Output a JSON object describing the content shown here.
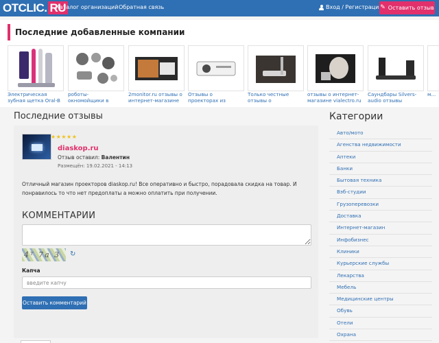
{
  "navbar": {
    "logo_main": "OTCLIC.",
    "logo_tld": "RU",
    "catalog_link": "Каталог организаций",
    "feedback_link": "Обратная связь",
    "login_link": "Вход / Регистрация",
    "review_button": "Оставить отзыв",
    "brand_color": "#2f6fb3",
    "accent_color": "#e1306c"
  },
  "companies": {
    "heading": "Последние добавленные компании",
    "items": [
      {
        "caption": "Электрическая зубная щетка Oral-B опыт..."
      },
      {
        "caption": "роботы-окномойщики в интернет-магазине..."
      },
      {
        "caption": "2monitor.ru отзывы о интернет-магазине"
      },
      {
        "caption": "Отзывы о проекторах из newskreen.ru"
      },
      {
        "caption": "Только честные отзывы о интернет-..."
      },
      {
        "caption": "отзывы о интернет-магазине vialectro.ru"
      },
      {
        "caption": "Саундбары Silvers-audio отзывы"
      },
      {
        "caption": "м..."
      }
    ]
  },
  "main": {
    "heading": "Последние отзывы",
    "review": {
      "stars": "★★★★★",
      "rating": 5,
      "title": "diaskop.ru",
      "author_label": "Отзыв оставил:",
      "author_name": "Валентин",
      "date": "Размещён: 19.02.2021 - 14:13",
      "text": "Отличный магазин проекторов diaskop.ru! Все оперативно и быстро, порадовала скидка на товар. И понравилось то что нет предоплаты а можно оплатить при получении."
    },
    "comments_title": "КОММЕНТАРИИ",
    "captcha_label": "Капча",
    "captcha_placeholder": "введите капчу",
    "submit_button": "Оставить комментарий"
  },
  "sidebar": {
    "heading": "Категории",
    "items": [
      "Авто/мото",
      "Агенства недвижимости",
      "Аптеки",
      "Банки",
      "Бытовая техника",
      "Вэб-студии",
      "Грузоперевозки",
      "Доставка",
      "Интернет-магазин",
      "Инфобизнес",
      "Клиники",
      "Курьерские службы",
      "Лекарства",
      "Мебель",
      "Медицинские центры",
      "Обувь",
      "Отели",
      "Охрана"
    ]
  }
}
